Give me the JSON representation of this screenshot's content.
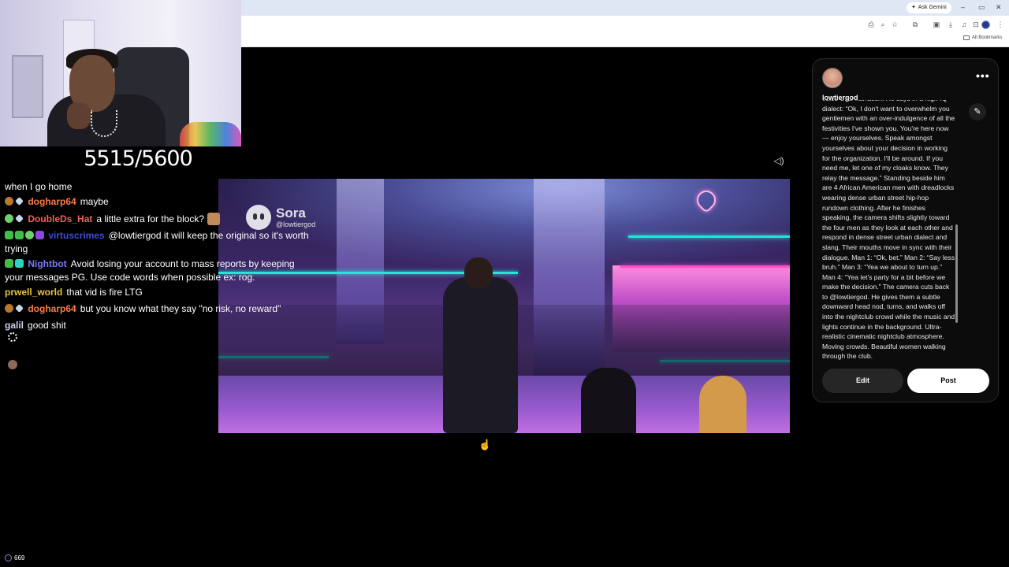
{
  "browser": {
    "ask_gemini": "Ask Gemini",
    "window_controls": [
      "–",
      "▭",
      "✕"
    ],
    "all_bookmarks": "All Bookmarks"
  },
  "stream": {
    "counter": "5515/5600",
    "viewer_count": "669"
  },
  "chat": {
    "messages": [
      {
        "user": "",
        "text": "when I go home",
        "user_color": "#ffffff"
      },
      {
        "user": "dogharp64",
        "text": "maybe",
        "user_color": "#ff7a45"
      },
      {
        "user": "DoubleDs_Hat",
        "text": "a little extra for the block?",
        "user_color": "#ff5a5a"
      },
      {
        "user": "virtuscrimes",
        "text": "@lowtiergod it will keep the original so it's worth",
        "user_color": "#3b4cd8"
      },
      {
        "user": "",
        "text": "trying",
        "user_color": "#ffffff"
      },
      {
        "user": "Nightbot",
        "text": "Avoid losing your account to mass reports by keeping",
        "user_color": "#7a7aff"
      },
      {
        "user": "",
        "text": "your messages PG. Use code words when possible ex: rog.",
        "user_color": "#ffffff"
      },
      {
        "user": "prwell_world",
        "text": "that vid is fire LTG",
        "user_color": "#e8c342"
      },
      {
        "user": "dogharp64",
        "text": "but you know what they say \"no risk, no reward\"",
        "user_color": "#ff7a45"
      },
      {
        "user": "galil",
        "text": "good shit",
        "user_color": "#c9d3ee"
      }
    ]
  },
  "player": {
    "watermark_name": "Sora",
    "watermark_handle": "@lowtiergod"
  },
  "panel": {
    "username": "lowtiergod",
    "more_label": "•••",
    "description": "voice-over narration. He says in a high-IQ dialect: “Ok, I don't want to overwhelm you gentlemen with an over-indulgence of all the festivities I've shown you. You're here now — enjoy yourselves. Speak amongst yourselves about your decision in working for the organization. I'll be around. If you need me, let one of my cloaks know. They relay the message.” Standing beside him are 4 African American men with dreadlocks wearing dense urban street hip-hop rundown clothing. After he finishes speaking, the camera shifts slightly toward the four men as they look at each other and respond in dense street urban dialect and slang. Their mouths move in sync with their dialogue. Man 1: “Ok, bet.” Man 2: “Say less bruh.” Man 3: “Yea we about to turn up.” Man 4: “Yea let's party for a bit before we make the decision.” The camera cuts back to @lowtiergod. He gives them a subtle downward head nod, turns, and walks off into the nightclub crowd while the music and lights continue in the background. Ultra-realistic cinematic nightclub atmosphere. Moving crowds. Beautiful women walking through the club.",
    "edit_label": "Edit",
    "post_label": "Post"
  },
  "colors": {
    "panel_bg": "#0c0c0c",
    "post_button": "#ffffff",
    "edit_button": "#262626",
    "neon_teal": "#22e6d8",
    "neon_pink": "#ff4fc8"
  }
}
